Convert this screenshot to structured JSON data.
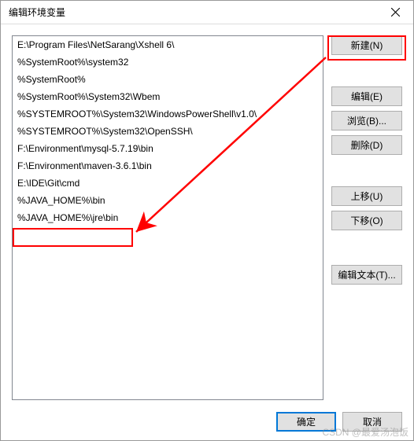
{
  "window": {
    "title": "编辑环境变量"
  },
  "list": {
    "items": [
      "E:\\Program Files\\NetSarang\\Xshell 6\\",
      "%SystemRoot%\\system32",
      "%SystemRoot%",
      "%SystemRoot%\\System32\\Wbem",
      "%SYSTEMROOT%\\System32\\WindowsPowerShell\\v1.0\\",
      "%SYSTEMROOT%\\System32\\OpenSSH\\",
      "F:\\Environment\\mysql-5.7.19\\bin",
      "F:\\Environment\\maven-3.6.1\\bin",
      "E:\\IDE\\Git\\cmd",
      "%JAVA_HOME%\\bin",
      "%JAVA_HOME%\\jre\\bin"
    ]
  },
  "buttons": {
    "new": "新建(N)",
    "edit": "编辑(E)",
    "browse": "浏览(B)...",
    "delete": "删除(D)",
    "moveUp": "上移(U)",
    "moveDown": "下移(O)",
    "editText": "编辑文本(T)...",
    "ok": "确定",
    "cancel": "取消"
  },
  "watermark": "CSDN @最爱汤泡饭"
}
